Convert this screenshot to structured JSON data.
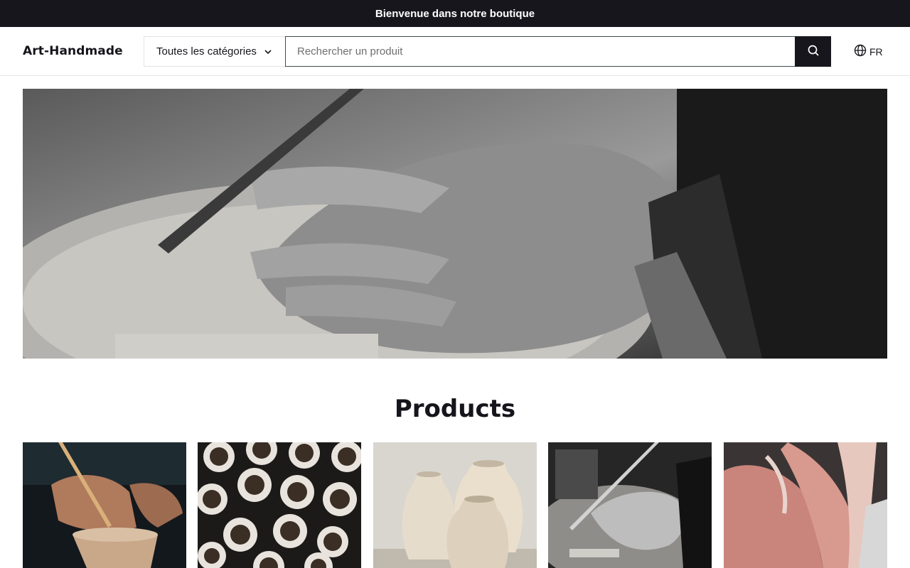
{
  "announcement": "Bienvenue dans notre boutique",
  "header": {
    "logo": "Art-Handmade",
    "category_select": "Toutes les catégories",
    "search_placeholder": "Rechercher un produit",
    "language": "FR"
  },
  "hero": {
    "icon": "craftsman-carving-wood-image"
  },
  "products": {
    "title": "Products",
    "items": [
      {
        "image": "pottery-carving-image"
      },
      {
        "image": "ceramic-cups-image"
      },
      {
        "image": "ceramic-vases-image"
      },
      {
        "image": "wood-carving-image"
      },
      {
        "image": "clay-hands-image"
      }
    ]
  },
  "colors": {
    "dark": "#17161d",
    "search_border": "#3f4c4c",
    "divider": "#e6e6e6"
  }
}
